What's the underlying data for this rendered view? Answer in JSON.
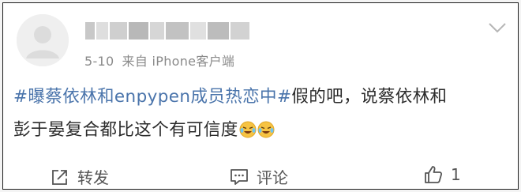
{
  "post": {
    "timestamp": "5-10",
    "source": "来自 iPhone客户端",
    "topic": "#曝蔡依林和enpypen成员热恋中#",
    "text_line1": "假的吧，说蔡依林和",
    "text_line2": "彭于晏复合都比这个有可信度",
    "emojis": [
      "laugh-cry-emoji",
      "laugh-cry-emoji"
    ]
  },
  "actions": {
    "repost_label": "转发",
    "comment_label": "评论",
    "like_count": "1"
  },
  "colors": {
    "topic": "#4a74ab",
    "text": "#2b2b2b",
    "meta": "#8a8a8a",
    "action": "#555555"
  },
  "icons": [
    "avatar-placeholder",
    "chevron-down-icon",
    "repost-icon",
    "comment-icon",
    "like-icon"
  ]
}
